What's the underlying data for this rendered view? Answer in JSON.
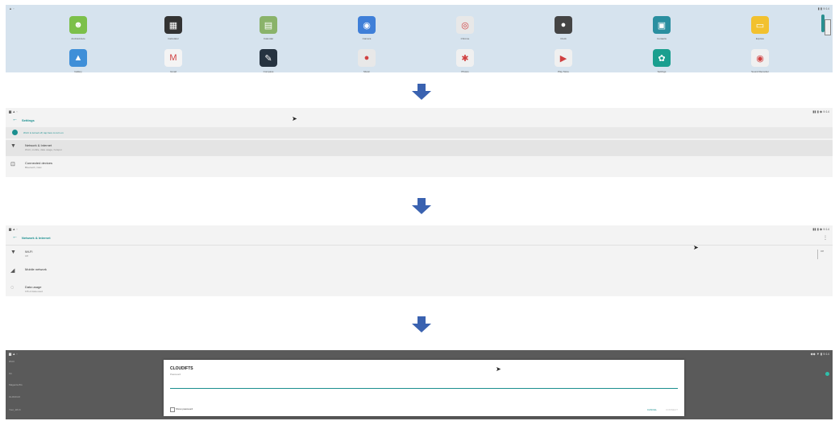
{
  "launcher": {
    "status_left": "▲ ◦",
    "status_right": "▮ ▮ 9:14",
    "apps_row1": [
      {
        "label": "Android Auto",
        "icon": "android-icon",
        "color": "#7cc04a",
        "glyph": "☻"
      },
      {
        "label": "Calculator",
        "icon": "calculator-icon",
        "color": "#333333",
        "glyph": "▦"
      },
      {
        "label": "Calendar",
        "icon": "calendar-icon",
        "color": "#8ab36a",
        "glyph": "▤"
      },
      {
        "label": "Camera",
        "icon": "camera-icon",
        "color": "#3f7fd8",
        "glyph": "◉"
      },
      {
        "label": "Chrome",
        "icon": "chrome-icon",
        "color": "#e8e8e8",
        "glyph": "◎"
      },
      {
        "label": "Clock",
        "icon": "clock-icon",
        "color": "#444444",
        "glyph": "●"
      },
      {
        "label": "Contacts",
        "icon": "contacts-icon",
        "color": "#2a8fa0",
        "glyph": "▣"
      },
      {
        "label": "Explore",
        "icon": "folder-icon",
        "color": "#f2c12e",
        "glyph": "▭"
      }
    ],
    "apps_row2": [
      {
        "label": "Gallery",
        "icon": "gallery-icon",
        "color": "#3f8fd8",
        "glyph": "▲"
      },
      {
        "label": "Gmail",
        "icon": "gmail-icon",
        "color": "#f4f4f4",
        "glyph": "M"
      },
      {
        "label": "Compass",
        "icon": "compass-icon",
        "color": "#263340",
        "glyph": "✎"
      },
      {
        "label": "Music",
        "icon": "music-icon",
        "color": "#e8e8e8",
        "glyph": "●"
      },
      {
        "label": "Photos",
        "icon": "photos-icon",
        "color": "#f0f0f0",
        "glyph": "✱"
      },
      {
        "label": "Play Store",
        "icon": "play-store-icon",
        "color": "#f0f0f0",
        "glyph": "▶"
      },
      {
        "label": "Settings",
        "icon": "settings-gear-icon",
        "color": "#1a9f8f",
        "glyph": "✿"
      },
      {
        "label": "Sound Recorder",
        "icon": "sound-recorder-icon",
        "color": "#f0f0f0",
        "glyph": "◉"
      }
    ]
  },
  "settings": {
    "status_left": "▆ ▲ ◦",
    "status_right": "▮▮ ▮ ◆ 9:14",
    "title": "Settings",
    "banner": "Wi-Fi is turned off, tap here to turn on",
    "rows": [
      {
        "title": "Network & Internet",
        "sub": "Wi-Fi, mobile, data usage, hotspot",
        "icon": "wifi-icon",
        "glyph": "▼"
      },
      {
        "title": "Connected devices",
        "sub": "Bluetooth, Cast",
        "icon": "devices-icon",
        "glyph": "⊡"
      }
    ]
  },
  "network": {
    "status_left": "▆ ▲ ◦",
    "status_right": "▮▮ ▮ ◆ 9:14",
    "title": "Network & Internet",
    "rows": [
      {
        "title": "Wi-Fi",
        "sub": "Off",
        "icon": "wifi-icon",
        "glyph": "▼"
      },
      {
        "title": "Mobile network",
        "sub": "",
        "icon": "signal-icon",
        "glyph": "◢"
      },
      {
        "title": "Data usage",
        "sub": "0 B of data used",
        "icon": "data-usage-icon",
        "glyph": "◌"
      }
    ],
    "toggle_label": "Off",
    "menu_glyph": "⋮"
  },
  "wifi_dialog": {
    "status_left": "▆ ▲ ◦",
    "status_right": "◆◆ ▼ ▮ 9:14",
    "bg_items": [
      "Wi-Fi",
      "On",
      "Magenta-5G",
      "CLOUD-FI",
      "Your_Wi-Fi"
    ],
    "title": "CLOUDIFTS",
    "field_label": "Password",
    "show_password": "Show password",
    "cancel": "CANCEL",
    "connect": "CONNECT"
  },
  "colors": {
    "accent": "#1a8f8f",
    "arrow": "#3a62b0"
  }
}
